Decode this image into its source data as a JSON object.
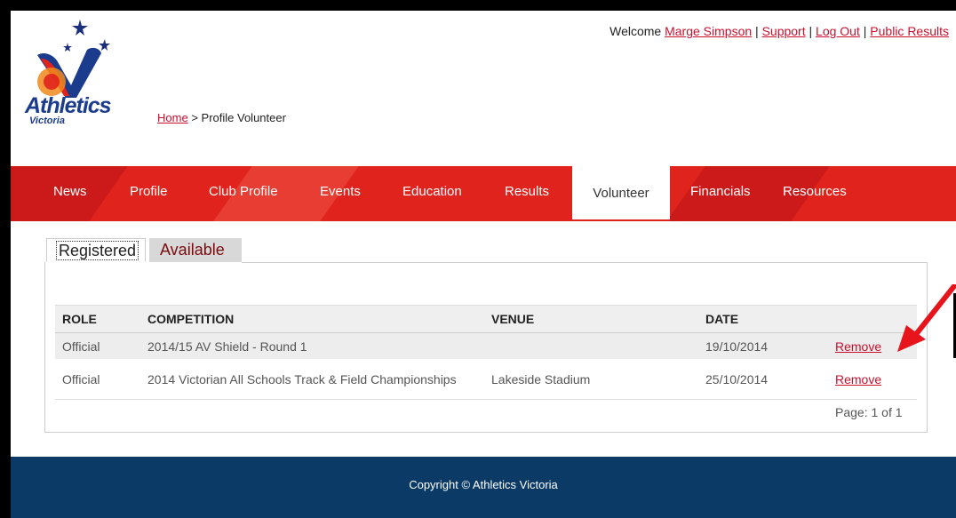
{
  "logo": {
    "name": "Athletics",
    "sub": "Victoria"
  },
  "header": {
    "welcome": "Welcome",
    "user": "Marge Simpson",
    "support": "Support",
    "logout": "Log Out",
    "public_results": "Public Results",
    "separator": "|"
  },
  "breadcrumb": {
    "home": "Home",
    "separator": ">",
    "current": "Profile Volunteer"
  },
  "nav": {
    "items": [
      "News",
      "Profile",
      "Club Profile",
      "Events",
      "Education",
      "Results",
      "Volunteer",
      "Financials",
      "Resources"
    ],
    "active": "Volunteer",
    "color": "#e0231c"
  },
  "tabs": {
    "registered": "Registered",
    "available": "Available"
  },
  "table": {
    "headers": [
      "ROLE",
      "COMPETITION",
      "VENUE",
      "DATE",
      ""
    ],
    "rows": [
      {
        "role": "Official",
        "competition": "2014/15 AV Shield - Round 1",
        "venue": "",
        "date": "19/10/2014",
        "action": "Remove"
      },
      {
        "role": "Official",
        "competition": "2014 Victorian All Schools Track & Field Championships",
        "venue": "Lakeside Stadium",
        "date": "25/10/2014",
        "action": "Remove"
      }
    ],
    "pager": "Page: 1 of 1"
  },
  "footer": {
    "copyright": "Copyright © Athletics Victoria",
    "color": "#0b3a66"
  },
  "annotation": {
    "arrow_color": "#e8141b"
  }
}
